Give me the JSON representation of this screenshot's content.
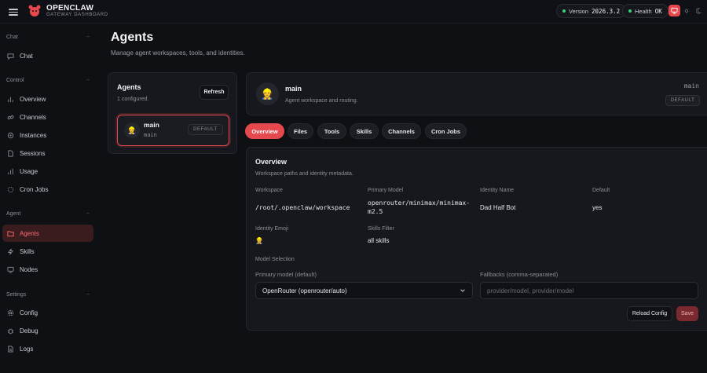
{
  "brand": {
    "title": "OPENCLAW",
    "subtitle": "GATEWAY DASHBOARD"
  },
  "topbar": {
    "version_label": "Version",
    "version_value": "2026.3.2",
    "health_label": "Health",
    "health_value": "OK",
    "status_color": "#3ed07a",
    "accent_color": "#e5484d"
  },
  "sidebar": {
    "groups": [
      {
        "label": "Chat",
        "items": [
          "Chat"
        ]
      },
      {
        "label": "Control",
        "items": [
          "Overview",
          "Channels",
          "Instances",
          "Sessions",
          "Usage",
          "Cron Jobs"
        ]
      },
      {
        "label": "Agent",
        "items": [
          "Agents",
          "Skills",
          "Nodes"
        ]
      },
      {
        "label": "Settings",
        "items": [
          "Config",
          "Debug",
          "Logs"
        ]
      }
    ],
    "active_item": "Agents"
  },
  "page": {
    "title": "Agents",
    "subtitle": "Manage agent workspaces, tools, and identities."
  },
  "agents_panel": {
    "title": "Agents",
    "count_text": "1 configured.",
    "refresh_label": "Refresh",
    "agents": [
      {
        "name": "main",
        "id": "main",
        "badge": "DEFAULT",
        "emoji": "👷"
      }
    ]
  },
  "agent_header": {
    "name": "main",
    "description": "Agent workspace and routing.",
    "id": "main",
    "badge": "DEFAULT",
    "emoji": "👷"
  },
  "tabs": [
    "Overview",
    "Files",
    "Tools",
    "Skills",
    "Channels",
    "Cron Jobs"
  ],
  "active_tab": "Overview",
  "overview": {
    "title": "Overview",
    "subtitle": "Workspace paths and identity metadata.",
    "workspace_label": "Workspace",
    "workspace_value": "/root/.openclaw/workspace",
    "primary_model_label": "Primary Model",
    "primary_model_value": "openrouter/minimax/minimax-m2.5",
    "identity_name_label": "Identity Name",
    "identity_name_value": "Dad Half Bot",
    "default_label": "Default",
    "default_value": "yes",
    "identity_emoji_label": "Identity Emoji",
    "identity_emoji_value": "👷",
    "skills_filter_label": "Skills Filter",
    "skills_filter_value": "all skills",
    "model_selection_label": "Model Selection",
    "primary_model_default_label": "Primary model (default)",
    "primary_model_select_value": "OpenRouter (openrouter/auto)",
    "fallbacks_label": "Fallbacks (comma-separated)",
    "fallbacks_placeholder": "provider/model, provider/model",
    "reload_label": "Reload Config",
    "save_label": "Save"
  }
}
